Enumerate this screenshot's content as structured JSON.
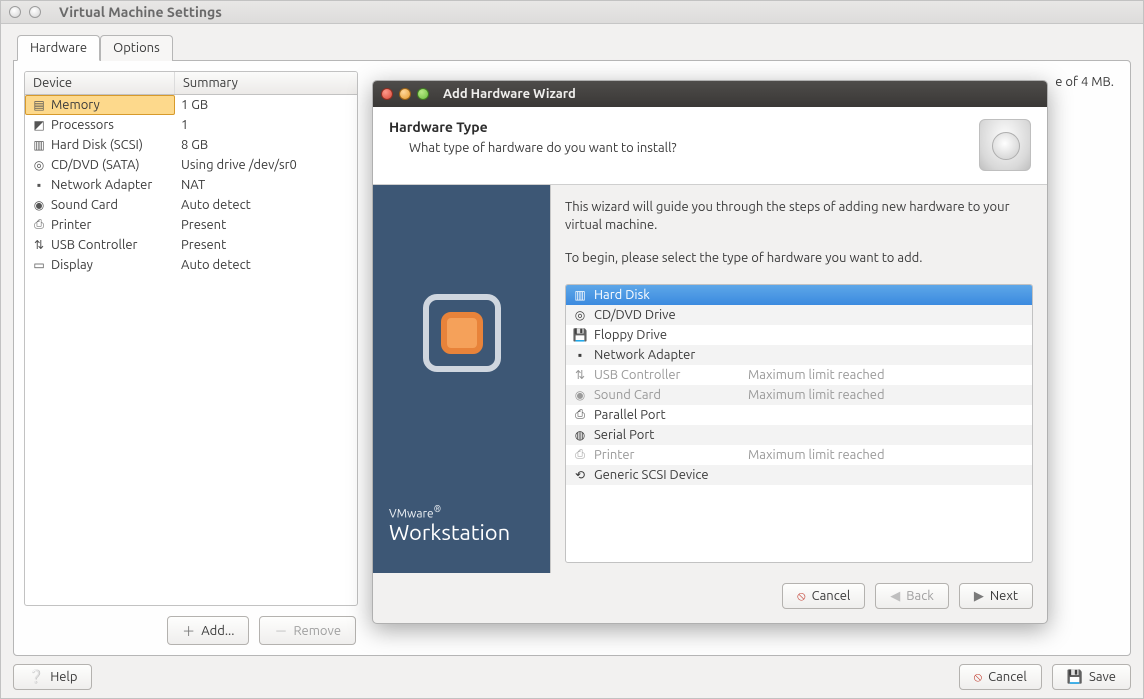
{
  "window": {
    "title": "Virtual Machine Settings"
  },
  "tabs": {
    "hardware": "Hardware",
    "options": "Options"
  },
  "device_table": {
    "header_device": "Device",
    "header_summary": "Summary",
    "rows": [
      {
        "device": "Memory",
        "summary": "1 GB",
        "icon": "▤"
      },
      {
        "device": "Processors",
        "summary": "1",
        "icon": "◩"
      },
      {
        "device": "Hard Disk (SCSI)",
        "summary": "8 GB",
        "icon": "▥"
      },
      {
        "device": "CD/DVD (SATA)",
        "summary": "Using drive /dev/sr0",
        "icon": "◎"
      },
      {
        "device": "Network Adapter",
        "summary": "NAT",
        "icon": "▪"
      },
      {
        "device": "Sound Card",
        "summary": "Auto detect",
        "icon": "◉"
      },
      {
        "device": "Printer",
        "summary": "Present",
        "icon": "⎙"
      },
      {
        "device": "USB Controller",
        "summary": "Present",
        "icon": "⇅"
      },
      {
        "device": "Display",
        "summary": "Auto detect",
        "icon": "▭"
      }
    ]
  },
  "side_buttons": {
    "add": "Add...",
    "remove": "Remove"
  },
  "bottom_buttons": {
    "help": "Help",
    "cancel": "Cancel",
    "save": "Save"
  },
  "right_panel": {
    "partial_text": "e of 4 MB."
  },
  "wizard": {
    "title": "Add Hardware Wizard",
    "header": {
      "heading": "Hardware Type",
      "sub": "What type of hardware do you want to install?"
    },
    "intro1": "This wizard will guide you through the steps of adding new hardware to your virtual machine.",
    "intro2": "To begin, please select the type of hardware you want to add.",
    "items": [
      {
        "label": "Hard Disk",
        "icon": "▥",
        "note": "",
        "selected": true,
        "disabled": false
      },
      {
        "label": "CD/DVD Drive",
        "icon": "◎",
        "note": "",
        "selected": false,
        "disabled": false
      },
      {
        "label": "Floppy Drive",
        "icon": "💾",
        "note": "",
        "selected": false,
        "disabled": false
      },
      {
        "label": "Network Adapter",
        "icon": "▪",
        "note": "",
        "selected": false,
        "disabled": false
      },
      {
        "label": "USB Controller",
        "icon": "⇅",
        "note": "Maximum limit reached",
        "selected": false,
        "disabled": true
      },
      {
        "label": "Sound Card",
        "icon": "◉",
        "note": "Maximum limit reached",
        "selected": false,
        "disabled": true
      },
      {
        "label": "Parallel Port",
        "icon": "⎙",
        "note": "",
        "selected": false,
        "disabled": false
      },
      {
        "label": "Serial Port",
        "icon": "◍",
        "note": "",
        "selected": false,
        "disabled": false
      },
      {
        "label": "Printer",
        "icon": "⎙",
        "note": "Maximum limit reached",
        "selected": false,
        "disabled": true
      },
      {
        "label": "Generic SCSI Device",
        "icon": "⟲",
        "note": "",
        "selected": false,
        "disabled": false
      }
    ],
    "brand": {
      "vmware": "VMware",
      "reg": "®",
      "workstation": "Workstation"
    },
    "buttons": {
      "cancel": "Cancel",
      "back": "Back",
      "next": "Next"
    }
  }
}
